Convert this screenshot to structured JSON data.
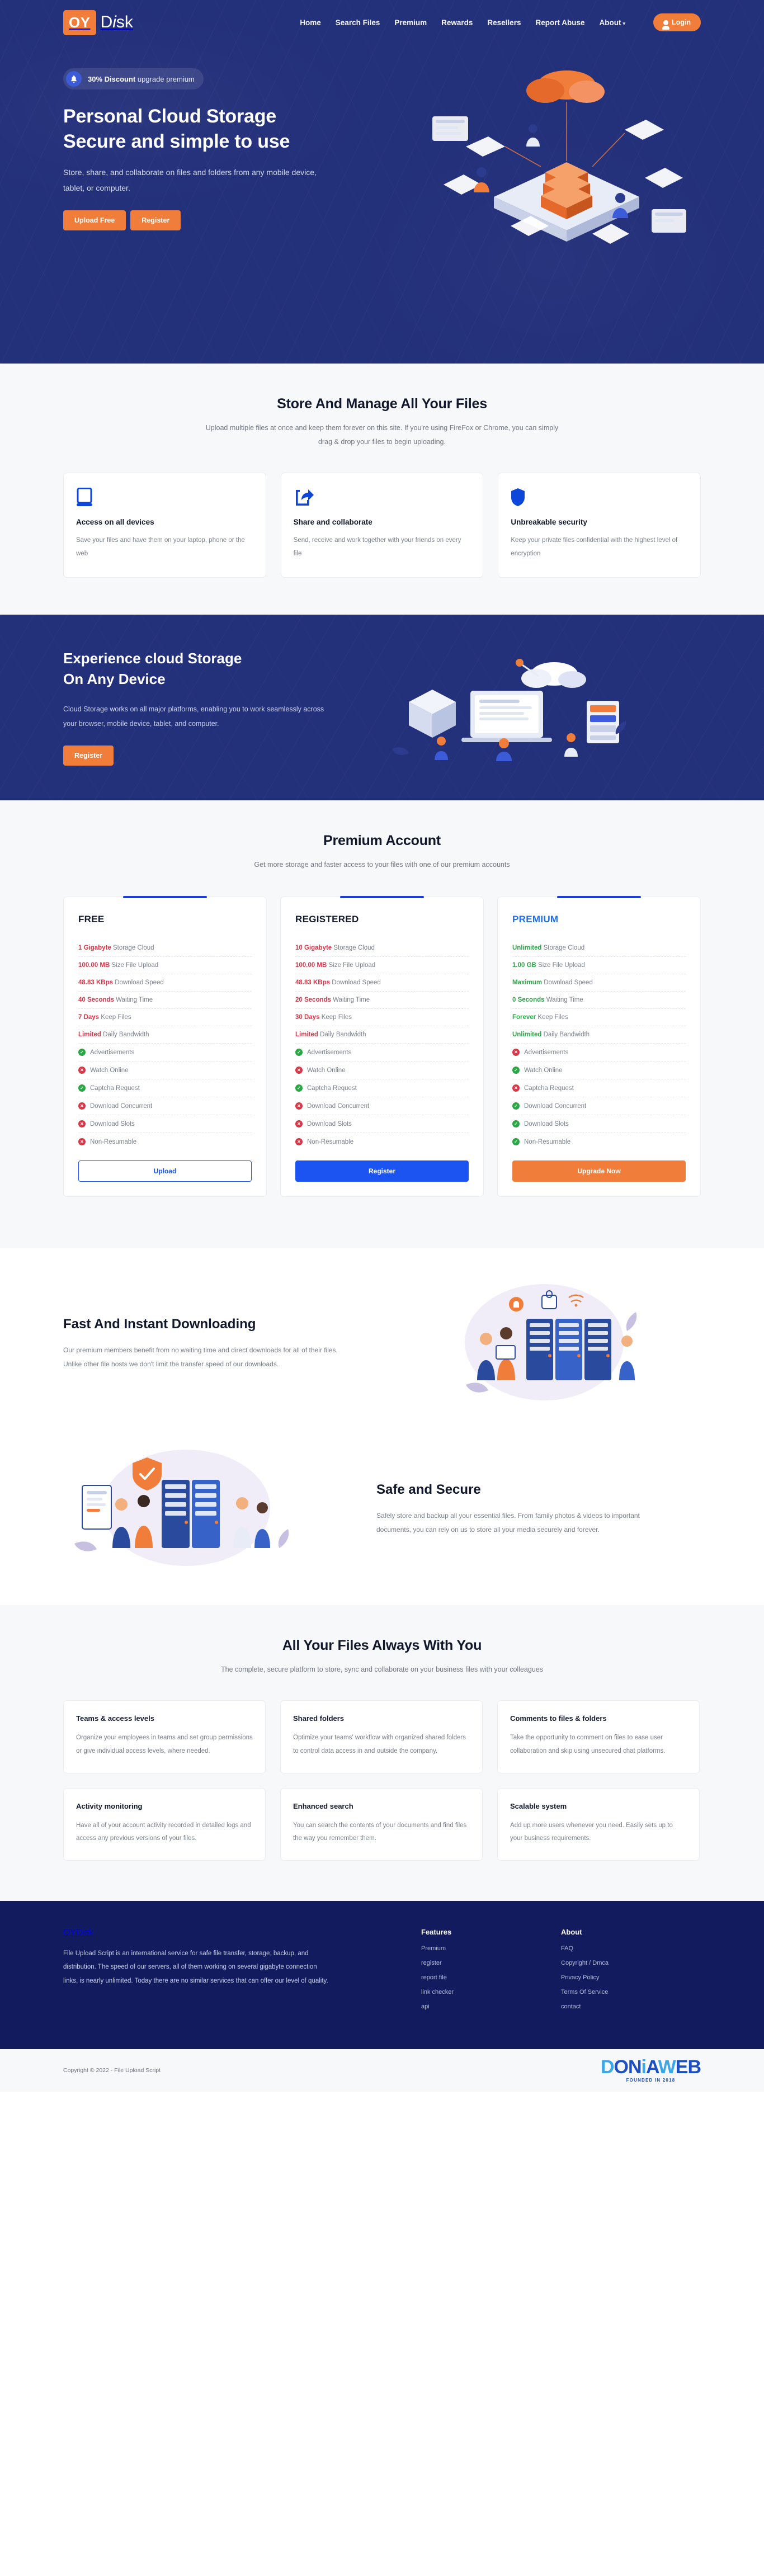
{
  "brand": {
    "mark": "OY",
    "name_a": "D",
    "name_i": "i",
    "name_b": "sk"
  },
  "nav": {
    "items": [
      {
        "label": "Home"
      },
      {
        "label": "Search Files"
      },
      {
        "label": "Premium"
      },
      {
        "label": "Rewards"
      },
      {
        "label": "Resellers"
      },
      {
        "label": "Report Abuse"
      },
      {
        "label": "About",
        "caret": "▾"
      }
    ],
    "login_label": "Login"
  },
  "hero": {
    "pill_bold": "30% Discount",
    "pill_rest": " upgrade premium",
    "bell_icon": "🔔",
    "title_line1": "Personal Cloud Storage",
    "title_line2": "Secure and simple to use",
    "subtitle": "Store, share, and collaborate on files and folders from any mobile device, tablet, or computer.",
    "btn_upload": "Upload Free",
    "btn_register": "Register"
  },
  "store_section": {
    "title": "Store And Manage All Your Files",
    "subtitle": "Upload multiple files at once and keep them forever on this site. If you're using FireFox or Chrome, you can simply drag & drop your files to begin uploading.",
    "cards": [
      {
        "icon": "device-icon",
        "title": "Access on all devices",
        "text": "Save your files and have them on your laptop, phone or the web"
      },
      {
        "icon": "share-icon",
        "title": "Share and collaborate",
        "text": "Send, receive and work together with your friends on every file"
      },
      {
        "icon": "shield-icon",
        "title": "Unbreakable security",
        "text": "Keep your private files confidential with the highest level of encryption"
      }
    ]
  },
  "experience_section": {
    "title_line1": "Experience cloud Storage",
    "title_line2": "On Any Device",
    "text": "Cloud Storage works on all major platforms, enabling you to work seamlessly across your browser, mobile device, tablet, and computer.",
    "btn_register": "Register"
  },
  "pricing": {
    "title": "Premium Account",
    "subtitle": "Get more storage and faster access to your files with one of our premium accounts",
    "spec_labels": [
      "Storage Cloud",
      "Size File Upload",
      "Download Speed",
      "Waiting Time",
      "Keep Files",
      "Daily Bandwidth"
    ],
    "feature_labels": [
      "Advertisements",
      "Watch Online",
      "Captcha Request",
      "Download Concurrent",
      "Download Slots",
      "Non-Resumable"
    ],
    "accent_bar_free": "#1b3fd6",
    "accent_bar_registered": "#1b3fd6",
    "accent_bar_premium": "#1b3fd6",
    "value_color_red": "#dc3545",
    "value_color_green": "#28a745",
    "plans": [
      {
        "name": "FREE",
        "name_color": "#12182b",
        "value_color": "#dc3545",
        "specs": [
          {
            "value": "1 Gigabyte",
            "label": "Storage Cloud"
          },
          {
            "value": "100.00 MB",
            "label": "Size File Upload"
          },
          {
            "value": "48.83 KBps",
            "label": "Download Speed"
          },
          {
            "value": "40 Seconds",
            "label": "Waiting Time"
          },
          {
            "value": "7 Days",
            "label": "Keep Files"
          },
          {
            "value": "Limited",
            "label": "Daily Bandwidth"
          }
        ],
        "features": [
          {
            "label": "Advertisements",
            "state": "yes"
          },
          {
            "label": "Watch Online",
            "state": "no"
          },
          {
            "label": "Captcha Request",
            "state": "yes"
          },
          {
            "label": "Download Concurrent",
            "state": "no"
          },
          {
            "label": "Download Slots",
            "state": "no"
          },
          {
            "label": "Non-Resumable",
            "state": "no"
          }
        ],
        "cta_label": "Upload",
        "cta_style": "outline"
      },
      {
        "name": "REGISTERED",
        "name_color": "#12182b",
        "value_color": "#dc3545",
        "specs": [
          {
            "value": "10 Gigabyte",
            "label": "Storage Cloud"
          },
          {
            "value": "100.00 MB",
            "label": "Size File Upload"
          },
          {
            "value": "48.83 KBps",
            "label": "Download Speed"
          },
          {
            "value": "20 Seconds",
            "label": "Waiting Time"
          },
          {
            "value": "30 Days",
            "label": "Keep Files"
          },
          {
            "value": "Limited",
            "label": "Daily Bandwidth"
          }
        ],
        "features": [
          {
            "label": "Advertisements",
            "state": "yes"
          },
          {
            "label": "Watch Online",
            "state": "no"
          },
          {
            "label": "Captcha Request",
            "state": "yes"
          },
          {
            "label": "Download Concurrent",
            "state": "no"
          },
          {
            "label": "Download Slots",
            "state": "no"
          },
          {
            "label": "Non-Resumable",
            "state": "no"
          }
        ],
        "cta_label": "Register",
        "cta_style": "solid-blue"
      },
      {
        "name": "PREMIUM",
        "name_color": "#1b6ff0",
        "value_color": "#28a745",
        "specs": [
          {
            "value": "Unlimited",
            "label": "Storage Cloud"
          },
          {
            "value": "1.00 GB",
            "label": "Size File Upload"
          },
          {
            "value": "Maximum",
            "label": "Download Speed"
          },
          {
            "value": "0 Seconds",
            "label": "Waiting Time"
          },
          {
            "value": "Forever",
            "label": "Keep Files"
          },
          {
            "value": "Unlimited",
            "label": "Daily Bandwidth"
          }
        ],
        "features": [
          {
            "label": "Advertisements",
            "state": "no"
          },
          {
            "label": "Watch Online",
            "state": "yes"
          },
          {
            "label": "Captcha Request",
            "state": "no"
          },
          {
            "label": "Download Concurrent",
            "state": "yes"
          },
          {
            "label": "Download Slots",
            "state": "yes"
          },
          {
            "label": "Non-Resumable",
            "state": "yes"
          }
        ],
        "cta_label": "Upgrade Now",
        "cta_style": "solid-orange"
      }
    ]
  },
  "fast_section": {
    "title": "Fast And Instant Downloading",
    "text": "Our premium members benefit from no waiting time and direct downloads for all of their files. Unlike other file hosts we don't limit the transfer speed of our downloads."
  },
  "safe_section": {
    "title": "Safe and Secure",
    "text": "Safely store and backup all your essential files. From family photos & videos to important documents, you can rely on us to store all your media securely and forever."
  },
  "always_section": {
    "title": "All Your Files Always With You",
    "subtitle": "The complete, secure platform to store, sync and collaborate on your business files with your colleagues",
    "cards": [
      {
        "title": "Teams & access levels",
        "text": "Organize your employees in teams and set group permissions or give individual access levels, where needed."
      },
      {
        "title": "Shared folders",
        "text": "Optimize your teams' workflow with organized shared folders to control data access in and outside the company."
      },
      {
        "title": "Comments to files & folders",
        "text": "Take the opportunity to comment on files to ease user collaboration and skip using unsecured chat platforms."
      },
      {
        "title": "Activity monitoring",
        "text": "Have all of your account activity recorded in detailed logs and access any previous versions of your files."
      },
      {
        "title": "Enhanced search",
        "text": "You can search the contents of your documents and find files the way you remember them."
      },
      {
        "title": "Scalable system",
        "text": "Add up more users whenever you need. Easily sets up to your business requirements."
      }
    ]
  },
  "footer": {
    "about_text": "File Upload Script is an international service for safe file transfer, storage, backup, and distribution. The speed of our servers, all of them working on several gigabyte connection links, is nearly unlimited. Today there are no similar services that can offer our level of quality.",
    "features_heading": "Features",
    "features_links": [
      "Premium",
      "register",
      "report file",
      "link checker",
      "api"
    ],
    "about_heading": "About",
    "about_links": [
      "FAQ",
      "Copyright / Dmca",
      "Privacy Policy",
      "Terms Of Service",
      "contact"
    ],
    "copyright": "Copyright © 2022 - File Upload Script",
    "watermark_main": "DONiAWEB",
    "watermark_sub": "FOUNDED IN 2018"
  },
  "colors": {
    "brand_orange": "#f07d3a",
    "brand_navy": "#23307a",
    "footer_navy": "#111b5e",
    "accent_blue": "#1b54f0",
    "green": "#28a745",
    "red": "#dc3545"
  }
}
